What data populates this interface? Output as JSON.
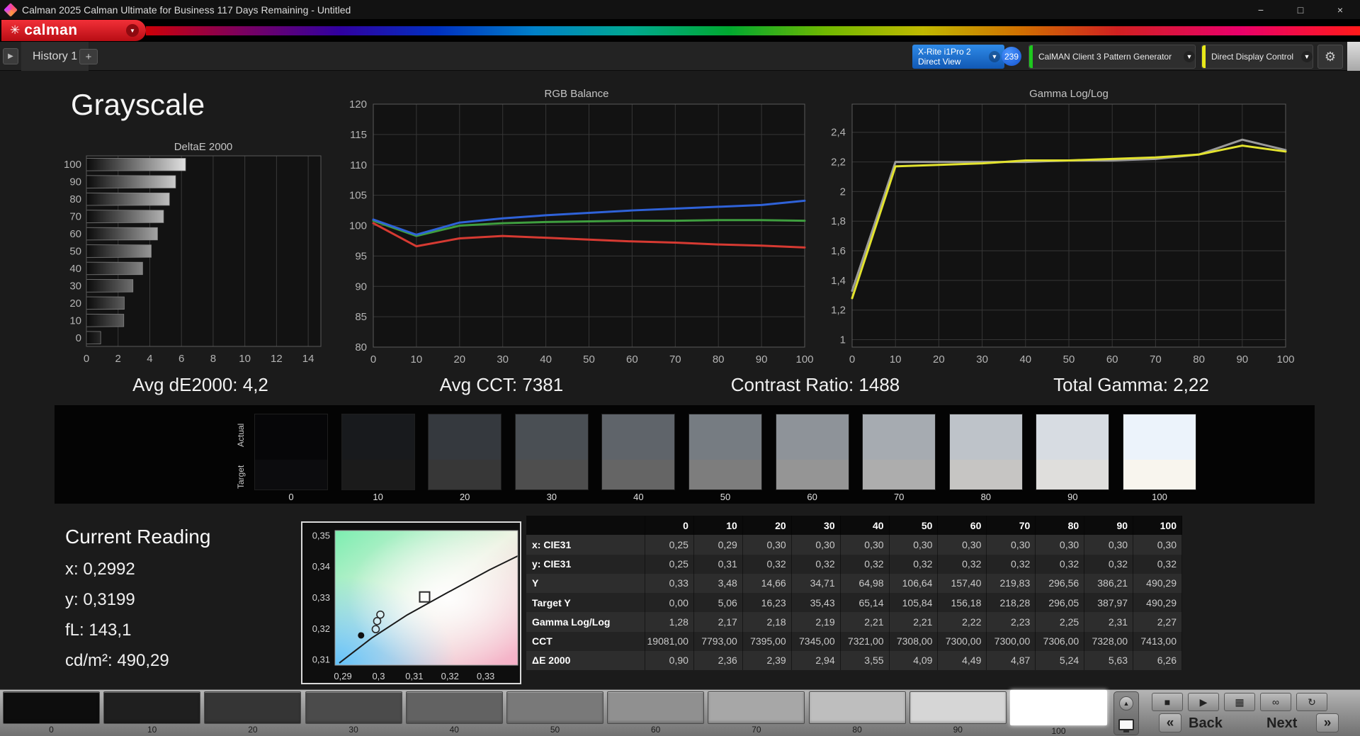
{
  "window": {
    "title": "Calman 2025 Calman Ultimate for Business 117 Days Remaining  - Untitled"
  },
  "icons": {
    "asterisk": "✳",
    "dropdown": "▼",
    "minimize": "−",
    "maximize": "□",
    "close": "×",
    "history_nav": "▶",
    "add_tab": "+",
    "gear": "⚙",
    "stop": "■",
    "play": "▶",
    "save": "▦",
    "link": "∞",
    "refresh": "↻",
    "back_chevrons": "«",
    "next_chevrons": "»",
    "panel_up": "▲"
  },
  "logo": {
    "text": "calman"
  },
  "tab_bar": {
    "history_tab": "History 1",
    "meter": {
      "line1": "X-Rite i1Pro 2",
      "line2": "Direct View"
    },
    "badge": "239",
    "pattern_generator": "CalMAN Client 3 Pattern Generator",
    "display_control": "Direct Display Control"
  },
  "page": {
    "title": "Grayscale"
  },
  "stats": {
    "avg_de": "Avg dE2000: 4,2",
    "avg_cct": "Avg CCT: 7381",
    "contrast": "Contrast Ratio: 1488",
    "total_gamma": "Total Gamma: 2,22"
  },
  "chart_data": [
    {
      "id": "deltae",
      "type": "bar",
      "title": "DeltaE 2000",
      "categories": [
        "100",
        "90",
        "80",
        "70",
        "60",
        "50",
        "40",
        "30",
        "20",
        "10",
        "0"
      ],
      "values": [
        6.26,
        5.63,
        5.24,
        4.87,
        4.49,
        4.09,
        3.55,
        2.94,
        2.39,
        2.36,
        0.9
      ],
      "xlim": [
        0,
        14.8
      ],
      "xticks": [
        0,
        2,
        4,
        6,
        8,
        10,
        12,
        14
      ]
    },
    {
      "id": "rgb_balance",
      "type": "line",
      "title": "RGB Balance",
      "x": [
        0,
        10,
        20,
        30,
        40,
        50,
        60,
        70,
        80,
        90,
        100
      ],
      "xticks": [
        0,
        10,
        20,
        30,
        40,
        50,
        60,
        70,
        80,
        90,
        100
      ],
      "ylim": [
        80,
        120
      ],
      "yticks": [
        80,
        85,
        90,
        95,
        100,
        105,
        110,
        115,
        120
      ],
      "series": [
        {
          "name": "Red",
          "color": "#d63a32",
          "values": [
            100.4,
            96.6,
            97.9,
            98.3,
            98.0,
            97.7,
            97.4,
            97.2,
            96.9,
            96.7,
            96.4
          ]
        },
        {
          "name": "Green",
          "color": "#3f9e3f",
          "values": [
            100.8,
            98.3,
            100.0,
            100.4,
            100.6,
            100.7,
            100.8,
            100.8,
            100.9,
            100.9,
            100.8
          ]
        },
        {
          "name": "Blue",
          "color": "#2f62d8",
          "values": [
            101.0,
            98.5,
            100.5,
            101.2,
            101.7,
            102.1,
            102.5,
            102.8,
            103.1,
            103.4,
            104.1
          ]
        }
      ]
    },
    {
      "id": "gamma",
      "type": "line",
      "title": "Gamma Log/Log",
      "x": [
        0,
        10,
        20,
        30,
        40,
        50,
        60,
        70,
        80,
        90,
        100
      ],
      "xticks": [
        0,
        10,
        20,
        30,
        40,
        50,
        60,
        70,
        80,
        90,
        100
      ],
      "ylim": [
        0.95,
        2.59
      ],
      "yticks": [
        1,
        1.2,
        1.4,
        1.6,
        1.8,
        2,
        2.2,
        2.4
      ],
      "ytick_labels": [
        "1",
        "1,2",
        "1,4",
        "1,6",
        "1,8",
        "2",
        "2,2",
        "2,4"
      ],
      "series": [
        {
          "name": "Reference",
          "color": "#9a9a9a",
          "values": [
            1.33,
            2.2,
            2.2,
            2.2,
            2.2,
            2.21,
            2.21,
            2.22,
            2.25,
            2.35,
            2.28
          ]
        },
        {
          "name": "Measured",
          "color": "#e3e32e",
          "values": [
            1.28,
            2.17,
            2.18,
            2.19,
            2.21,
            2.21,
            2.22,
            2.23,
            2.25,
            2.31,
            2.27
          ]
        }
      ]
    },
    {
      "id": "cie",
      "type": "scatter",
      "title": "CIE 1931 xy detail",
      "xlim": [
        0.2878,
        0.339
      ],
      "ylim": [
        0.3083,
        0.3517
      ],
      "xticks": [
        0.29,
        0.3,
        0.31,
        0.32,
        0.33
      ],
      "xtick_labels": [
        "0,29",
        "0,3",
        "0,31",
        "0,32",
        "0,33"
      ],
      "yticks": [
        0.31,
        0.32,
        0.33,
        0.34,
        0.35
      ],
      "ytick_labels": [
        "0,31",
        "0,32",
        "0,33",
        "0,34",
        "0,35"
      ],
      "locus": [
        [
          0.289,
          0.309
        ],
        [
          0.298,
          0.317
        ],
        [
          0.308,
          0.3245
        ],
        [
          0.319,
          0.3315
        ],
        [
          0.331,
          0.339
        ],
        [
          0.339,
          0.3435
        ]
      ],
      "target_point": [
        0.3129,
        0.3303
      ],
      "measured_points": [
        [
          0.3005,
          0.3246
        ],
        [
          0.2996,
          0.3225
        ],
        [
          0.2992,
          0.3199
        ]
      ],
      "reference_point": [
        0.2951,
        0.3179
      ]
    }
  ],
  "swatches": {
    "row_labels": [
      "Actual",
      "Target"
    ],
    "items": [
      {
        "label": "0",
        "actual": "#060608",
        "target": "#0c0c0e"
      },
      {
        "label": "10",
        "actual": "#181a1d",
        "target": "#1b1b1b"
      },
      {
        "label": "20",
        "actual": "#35393e",
        "target": "#373737"
      },
      {
        "label": "30",
        "actual": "#4a4f54",
        "target": "#4e4e4e"
      },
      {
        "label": "40",
        "actual": "#5f646a",
        "target": "#656565"
      },
      {
        "label": "50",
        "actual": "#767c82",
        "target": "#7d7d7d"
      },
      {
        "label": "60",
        "actual": "#8e9399",
        "target": "#959595"
      },
      {
        "label": "70",
        "actual": "#a6abb1",
        "target": "#adadad"
      },
      {
        "label": "80",
        "actual": "#bec3c9",
        "target": "#c6c5c3"
      },
      {
        "label": "90",
        "actual": "#d7dce2",
        "target": "#dfdedc"
      },
      {
        "label": "100",
        "actual": "#ecf3fb",
        "target": "#f8f5ee"
      }
    ]
  },
  "current_reading": {
    "title": "Current Reading",
    "lines": [
      "x: 0,2992",
      "y: 0,3199",
      "fL: 143,1",
      "cd/m²: 490,29"
    ]
  },
  "table": {
    "columns": [
      "0",
      "10",
      "20",
      "30",
      "40",
      "50",
      "60",
      "70",
      "80",
      "90",
      "100"
    ],
    "rows": [
      {
        "label": "x: CIE31",
        "values": [
          "0,25",
          "0,29",
          "0,30",
          "0,30",
          "0,30",
          "0,30",
          "0,30",
          "0,30",
          "0,30",
          "0,30",
          "0,30"
        ]
      },
      {
        "label": "y: CIE31",
        "values": [
          "0,25",
          "0,31",
          "0,32",
          "0,32",
          "0,32",
          "0,32",
          "0,32",
          "0,32",
          "0,32",
          "0,32",
          "0,32"
        ]
      },
      {
        "label": "Y",
        "values": [
          "0,33",
          "3,48",
          "14,66",
          "34,71",
          "64,98",
          "106,64",
          "157,40",
          "219,83",
          "296,56",
          "386,21",
          "490,29"
        ]
      },
      {
        "label": "Target Y",
        "values": [
          "0,00",
          "5,06",
          "16,23",
          "35,43",
          "65,14",
          "105,84",
          "156,18",
          "218,28",
          "296,05",
          "387,97",
          "490,29"
        ]
      },
      {
        "label": "Gamma Log/Log",
        "values": [
          "1,28",
          "2,17",
          "2,18",
          "2,19",
          "2,21",
          "2,21",
          "2,22",
          "2,23",
          "2,25",
          "2,31",
          "2,27"
        ]
      },
      {
        "label": "CCT",
        "values": [
          "19081,00",
          "7793,00",
          "7395,00",
          "7345,00",
          "7321,00",
          "7308,00",
          "7300,00",
          "7300,00",
          "7306,00",
          "7328,00",
          "7413,00"
        ]
      },
      {
        "label": "ΔE 2000",
        "values": [
          "0,90",
          "2,36",
          "2,39",
          "2,94",
          "3,55",
          "4,09",
          "4,49",
          "4,87",
          "5,24",
          "5,63",
          "6,26"
        ]
      }
    ]
  },
  "pattern_bar": {
    "items": [
      {
        "label": "0",
        "color": "#0d0d0d"
      },
      {
        "label": "10",
        "color": "#1f1f1f"
      },
      {
        "label": "20",
        "color": "#353535"
      },
      {
        "label": "30",
        "color": "#4b4b4b"
      },
      {
        "label": "40",
        "color": "#626262"
      },
      {
        "label": "50",
        "color": "#797979"
      },
      {
        "label": "60",
        "color": "#909090"
      },
      {
        "label": "70",
        "color": "#a7a7a7"
      },
      {
        "label": "80",
        "color": "#bebebe"
      },
      {
        "label": "90",
        "color": "#d6d6d6"
      },
      {
        "label": "100",
        "color": "#ffffff",
        "selected": true
      }
    ]
  },
  "transport": {
    "back": "Back",
    "next": "Next"
  }
}
